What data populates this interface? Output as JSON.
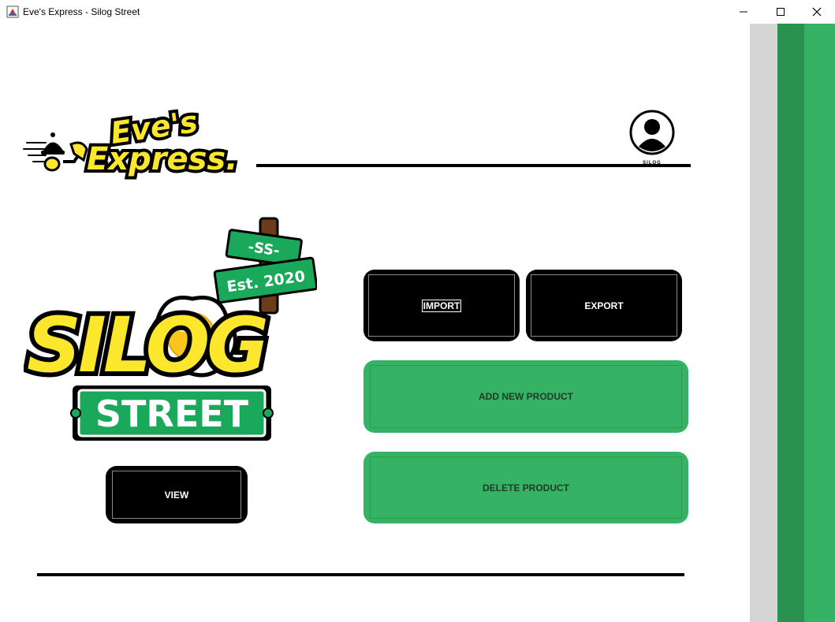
{
  "window": {
    "title": "Eve's Express - Silog Street",
    "controls": [
      "minimize-icon",
      "maximize-icon",
      "close-icon"
    ]
  },
  "header": {
    "brand_line1": "Eve's",
    "brand_line2": "Express.",
    "user_label": "SILOG"
  },
  "store_logo": {
    "sign_top": "-SS-",
    "sign_est": "Est. 2020",
    "name_top": "SILOG",
    "name_bottom": "STREET"
  },
  "actions": {
    "import_label": "IMPORT",
    "export_label": "EXPORT",
    "add_label": "ADD NEW PRODUCT",
    "delete_label": "DELETE PRODUCT",
    "view_label": "VIEW"
  },
  "colors": {
    "green": "#35b263",
    "dark_green": "#2a9250",
    "gray": "#d4d4d4",
    "yellow": "#fde72d",
    "black": "#000000"
  }
}
